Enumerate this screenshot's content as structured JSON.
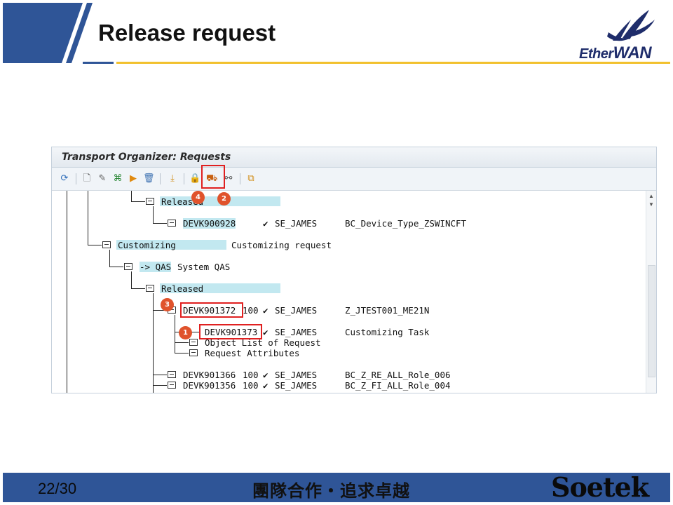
{
  "slide": {
    "title": "Release request",
    "page": "22/30",
    "motto": "團隊合作・追求卓越",
    "footer_brand": "Soetek",
    "logo_text_a": "E",
    "logo_text_b": "ther",
    "logo_text_c": "WAN",
    "colors": {
      "header_blue": "#2f5597",
      "gold": "#f2c12e",
      "highlight": "#c2e8f0",
      "callout_red": "#e02020"
    }
  },
  "sap": {
    "window_title": "Transport Organizer: Requests",
    "toolbar_icons": [
      "refresh-icon",
      "new-icon",
      "change-icon",
      "hierarchy-icon",
      "release-directly-icon",
      "delete-icon",
      "import-icon",
      "lock-icon",
      "release-truck-icon",
      "display-icon",
      "copy-icon"
    ],
    "tree": {
      "released_top": "Released",
      "devk900928": {
        "id": "DEVK900928",
        "check": "✔",
        "owner": "SE_JAMES",
        "desc": "BC_Device_Type_ZSWINCFT"
      },
      "customizing": {
        "label": "Customizing",
        "desc": "Customizing request"
      },
      "qas": {
        "label": "-> QAS",
        "desc": "System QAS"
      },
      "released": "Released",
      "devk901372": {
        "id": "DEVK901372",
        "client": "100",
        "check": "✔",
        "owner": "SE_JAMES",
        "desc": "Z_JTEST001_ME21N"
      },
      "devk901373": {
        "id": "DEVK901373",
        "check": "✔",
        "owner": "SE_JAMES",
        "desc": "Customizing Task"
      },
      "object_list": "Object List of Request",
      "request_attributes": "Request Attributes",
      "devk901366": {
        "id": "DEVK901366",
        "client": "100",
        "check": "✔",
        "owner": "SE_JAMES",
        "desc": "BC_Z_RE_ALL_Role_006"
      },
      "devk901356": {
        "id": "DEVK901356",
        "client": "100",
        "check": "✔",
        "owner": "SE_JAMES",
        "desc": "BC_Z_FI_ALL_Role_004"
      }
    },
    "callouts": [
      "1",
      "2",
      "3",
      "4"
    ]
  }
}
